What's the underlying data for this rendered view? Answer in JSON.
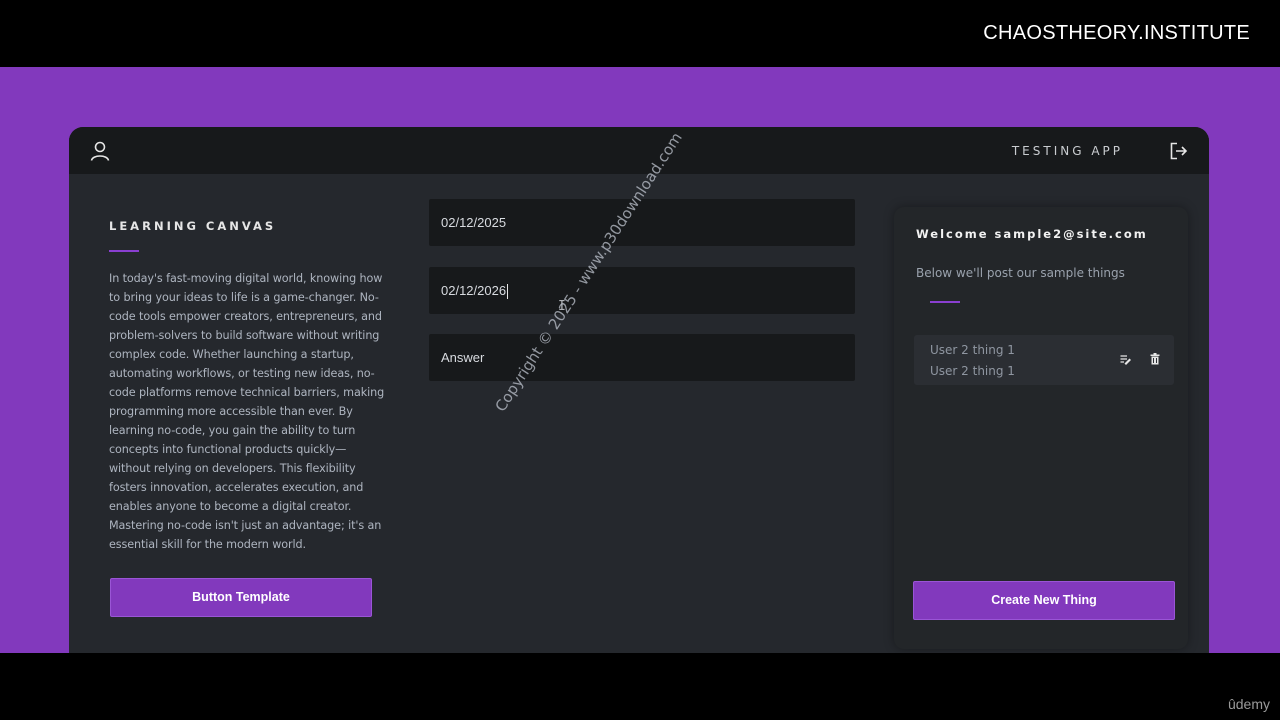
{
  "overlay": {
    "brand": "CHAOSTHEORY.INSTITUTE",
    "platform": "ûdemy",
    "watermark": "Copyright © 2025 - www.p30download.com"
  },
  "header": {
    "app_name": "TESTING APP",
    "icons": {
      "user": "user-icon",
      "logout": "logout-icon"
    }
  },
  "left": {
    "title": "LEARNING CANVAS",
    "body": "In today's fast-moving digital world, knowing how to bring your ideas to life is a game-changer. No-code tools empower creators, entrepreneurs, and problem-solvers to build software without writing complex code. Whether launching a startup, automating workflows, or testing new ideas, no-code platforms remove technical barriers, making programming more accessible than ever. By learning no-code, you gain the ability to turn concepts into functional products quickly—without relying on developers. This flexibility fosters innovation, accelerates execution, and enables anyone to become a digital creator. Mastering no-code isn't just an advantage; it's an essential skill for the modern world.",
    "button_label": "Button Template"
  },
  "form": {
    "date_start": "02/12/2025",
    "date_end": "02/12/2026",
    "answer": "Answer"
  },
  "panel": {
    "welcome": "Welcome sample2@site.com",
    "subtitle": "Below we'll post our sample things",
    "things": [
      "User 2 thing 1",
      "User 2 thing 1"
    ],
    "create_label": "Create New Thing"
  },
  "colors": {
    "accent": "#8239bd",
    "app_bg": "#25282d",
    "header_bg": "#17191b"
  }
}
